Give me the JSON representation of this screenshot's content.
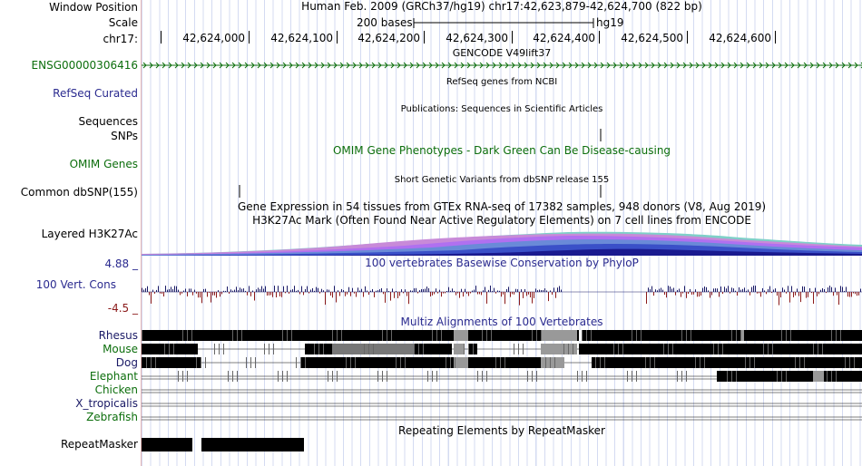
{
  "header": {
    "window_position_label": "Window Position",
    "window_position_value": "Human Feb. 2009 (GRCh37/hg19)   chr17:42,623,879-42,624,700 (822 bp)",
    "scale_label": "Scale",
    "scale_text": "200 bases",
    "scale_assembly": "hg19",
    "chrom_label": "chr17:",
    "ruler_ticks": [
      "42,624,000",
      "42,624,100",
      "42,624,200",
      "42,624,300",
      "42,624,400",
      "42,624,500",
      "42,624,600"
    ]
  },
  "tracks": {
    "gencode": {
      "title": "GENCODE V49lift37",
      "label": "ENSG00000306416"
    },
    "refseq": {
      "title": "RefSeq genes from NCBI",
      "label": "RefSeq Curated"
    },
    "publications": {
      "title": "Publications: Sequences in Scientific Articles",
      "label": "Sequences"
    },
    "snps": {
      "label": "SNPs"
    },
    "omim": {
      "title": "OMIM Gene Phenotypes - Dark Green Can Be Disease-causing",
      "label": "OMIM Genes"
    },
    "dbsnp": {
      "title": "Short Genetic Variants from dbSNP release 155",
      "label": "Common dbSNP(155)"
    },
    "gtex": {
      "title": "Gene Expression in 54 tissues from GTEx RNA-seq of 17382 samples, 948 donors (V8, Aug 2019)"
    },
    "h3k27ac": {
      "title": "H3K27Ac Mark (Often Found Near Active Regulatory Elements) on 7 cell lines from ENCODE",
      "label": "Layered H3K27Ac"
    },
    "conservation": {
      "title": "100 vertebrates Basewise Conservation by PhyloP",
      "label": "100 Vert. Cons",
      "max_label": "4.88 _",
      "min_label": "-4.5 _"
    },
    "multiz": {
      "title": "Multiz Alignments of 100 Vertebrates",
      "species": [
        {
          "name": "Rhesus",
          "color": "#1a1a66"
        },
        {
          "name": "Mouse",
          "color": "#0c6e0c"
        },
        {
          "name": "Dog",
          "color": "#1a1a66"
        },
        {
          "name": "Elephant",
          "color": "#0c6e0c"
        },
        {
          "name": "Chicken",
          "color": "#0c6e0c"
        },
        {
          "name": "X_tropicalis",
          "color": "#1a1a66"
        },
        {
          "name": "Zebrafish",
          "color": "#0c6e0c"
        }
      ]
    },
    "repeatmasker": {
      "title": "Repeating Elements by RepeatMasker",
      "label": "RepeatMasker"
    }
  },
  "colors": {
    "gencode_green": "#0c6e0c",
    "label_blue": "#2a2a8f",
    "label_green": "#0c6e0c",
    "conservation_pos": "#1a1a66",
    "conservation_neg": "#8b1a1a"
  }
}
